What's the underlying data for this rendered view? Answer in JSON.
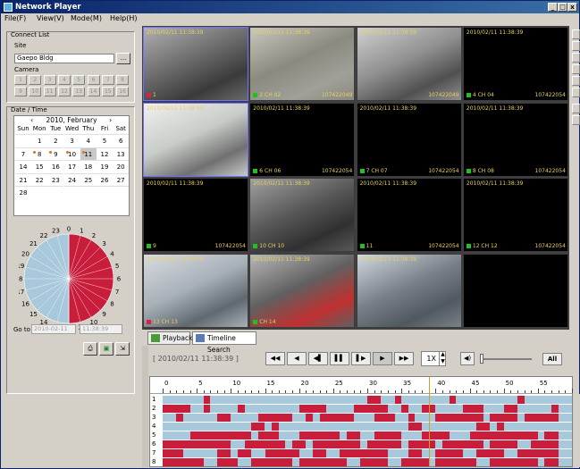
{
  "window": {
    "title": "Network Player"
  },
  "menu": [
    "File(F)",
    "View(V)",
    "Mode(M)",
    "Help(H)"
  ],
  "connect": {
    "group_title": "Connect List",
    "site_label": "Site",
    "site_value": "Gaepo Bldg",
    "site_button": "...",
    "camera_label": "Camera",
    "cameras": [
      "1",
      "2",
      "3",
      "4",
      "5",
      "6",
      "7",
      "8",
      "9",
      "10",
      "11",
      "12",
      "13",
      "14",
      "15",
      "16"
    ]
  },
  "datetime": {
    "group_title": "Date / Time",
    "month_label": "2010, February",
    "weekdays": [
      "Sun",
      "Mon",
      "Tue",
      "Wed",
      "Thu",
      "Fri",
      "Sat"
    ],
    "weeks": [
      [
        "",
        "1",
        "2",
        "3",
        "4",
        "5",
        "6"
      ],
      [
        "7",
        "8",
        "9",
        "10",
        "11",
        "12",
        "13"
      ],
      [
        "14",
        "15",
        "16",
        "17",
        "18",
        "19",
        "20"
      ],
      [
        "21",
        "22",
        "23",
        "24",
        "25",
        "26",
        "27"
      ],
      [
        "28",
        "",
        "",
        "",
        "",
        "",
        ""
      ]
    ],
    "marked_days": [
      "8",
      "9",
      "10",
      "11"
    ],
    "selected_day": "11",
    "clock_hours": [
      "0",
      "1",
      "2",
      "3",
      "4",
      "5",
      "6",
      "7",
      "8",
      "9",
      "10",
      "11",
      "12",
      "13",
      "14",
      "15",
      "16",
      "17",
      "18",
      "19",
      "20",
      "21",
      "22",
      "23"
    ],
    "clock_recorded_fraction": 0.5,
    "goto_label": "Go to",
    "goto_date": "2010-02-11",
    "goto_time": "11:38:39"
  },
  "colors": {
    "recorded": "#c81e3c",
    "empty": "#a8c8dc",
    "cursor": "#d4a020",
    "osd_text": "#e8d060"
  },
  "grid": {
    "timestamp": "2010/02/11 11:38:39",
    "cells": [
      {
        "label": "1",
        "id": "",
        "scene": "stairs-person"
      },
      {
        "label": "2 CH 02",
        "id": "107422049",
        "scene": "elevator"
      },
      {
        "label": "",
        "id": "107422049",
        "scene": "stairs"
      },
      {
        "label": "4 CH 04",
        "id": "107422054",
        "scene": "black"
      },
      {
        "label": "",
        "id": "",
        "scene": "garage"
      },
      {
        "label": "6 CH 06",
        "id": "107422054",
        "scene": "black"
      },
      {
        "label": "7 CH 07",
        "id": "107422054",
        "scene": "black"
      },
      {
        "label": "8 CH 08",
        "id": "107422054",
        "scene": "black"
      },
      {
        "label": "9",
        "id": "107422054",
        "scene": "black"
      },
      {
        "label": "10 CH 10",
        "id": "",
        "scene": "parking"
      },
      {
        "label": "11",
        "id": "107422054",
        "scene": "black"
      },
      {
        "label": "12 CH 12",
        "id": "107422054",
        "scene": "black"
      },
      {
        "label": "13 CH 13",
        "id": "",
        "scene": "office"
      },
      {
        "label": "CH 14",
        "id": "",
        "scene": "street"
      },
      {
        "label": "",
        "id": "",
        "scene": "city"
      },
      {
        "label": "",
        "id": "",
        "scene": "empty"
      }
    ]
  },
  "tabs": [
    "Playback",
    "Timeline Search"
  ],
  "playback": {
    "time": "[ 2010/02/11 11:38:39 ]",
    "buttons": [
      "◀◀",
      "◀",
      "◀▌",
      "▌▌",
      "▌▶",
      "▶",
      "▶▶"
    ],
    "speed": "1X",
    "all_label": "All",
    "volume": 0
  },
  "timeline": {
    "ticks": [
      "0",
      "5",
      "10",
      "15",
      "20",
      "25",
      "30",
      "35",
      "40",
      "45",
      "50",
      "55"
    ],
    "rows": [
      "1",
      "2",
      "3",
      "4",
      "5",
      "6",
      "7",
      "8"
    ],
    "cursor_minute": 39,
    "segments": [
      [
        [
          6,
          7
        ],
        [
          30,
          32
        ],
        [
          34,
          35
        ],
        [
          42,
          43
        ],
        [
          52,
          53
        ]
      ],
      [
        [
          0,
          4
        ],
        [
          6,
          7
        ],
        [
          11,
          12
        ],
        [
          20,
          24
        ],
        [
          28,
          33
        ],
        [
          35,
          36
        ],
        [
          38,
          40
        ],
        [
          44,
          47
        ],
        [
          50,
          52
        ],
        [
          57,
          58
        ]
      ],
      [
        [
          2,
          3
        ],
        [
          8,
          10
        ],
        [
          14,
          19
        ],
        [
          21,
          22
        ],
        [
          23,
          28
        ],
        [
          31,
          34
        ],
        [
          36,
          37
        ],
        [
          40,
          47
        ],
        [
          48,
          52
        ],
        [
          53,
          58
        ]
      ],
      [
        [
          13,
          15
        ],
        [
          16,
          17
        ],
        [
          36,
          38
        ],
        [
          46,
          48
        ],
        [
          49,
          50
        ]
      ],
      [
        [
          4,
          13
        ],
        [
          14,
          17
        ],
        [
          20,
          26
        ],
        [
          27,
          29
        ],
        [
          31,
          35
        ],
        [
          38,
          42
        ],
        [
          45,
          55
        ],
        [
          56,
          58
        ]
      ],
      [
        [
          0,
          10
        ],
        [
          12,
          18
        ],
        [
          19,
          21
        ],
        [
          22,
          29
        ],
        [
          30,
          35
        ],
        [
          36,
          40
        ],
        [
          41,
          47
        ],
        [
          48,
          52
        ],
        [
          54,
          58
        ]
      ],
      [
        [
          0,
          3
        ],
        [
          8,
          10
        ],
        [
          11,
          13
        ],
        [
          15,
          20
        ],
        [
          22,
          24
        ],
        [
          26,
          33
        ],
        [
          36,
          38
        ],
        [
          40,
          44
        ],
        [
          46,
          50
        ],
        [
          52,
          58
        ]
      ],
      [
        [
          0,
          6
        ],
        [
          8,
          11
        ],
        [
          13,
          19
        ],
        [
          20,
          27
        ],
        [
          29,
          33
        ],
        [
          35,
          39
        ],
        [
          40,
          46
        ],
        [
          48,
          55
        ],
        [
          56,
          58
        ]
      ]
    ]
  }
}
